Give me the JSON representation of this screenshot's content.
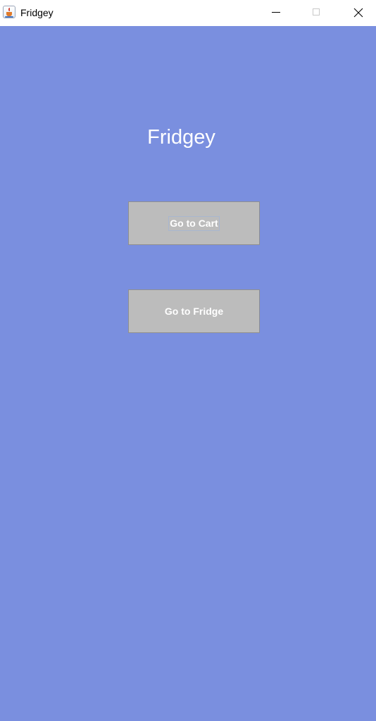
{
  "window": {
    "title": "Fridgey",
    "controls": [
      "minimize",
      "maximize",
      "close"
    ]
  },
  "main": {
    "heading": "Fridgey",
    "buttons": [
      {
        "label": "Go to Cart",
        "focused": true
      },
      {
        "label": "Go to Fridge",
        "focused": false
      }
    ]
  },
  "colors": {
    "background": "#7a8fdf",
    "button": "#bcbcbc",
    "text": "#ffffff"
  },
  "icons": {
    "app": "java-coffee-cup-icon",
    "minimize": "minimize-icon",
    "maximize": "maximize-icon",
    "close": "close-icon"
  }
}
